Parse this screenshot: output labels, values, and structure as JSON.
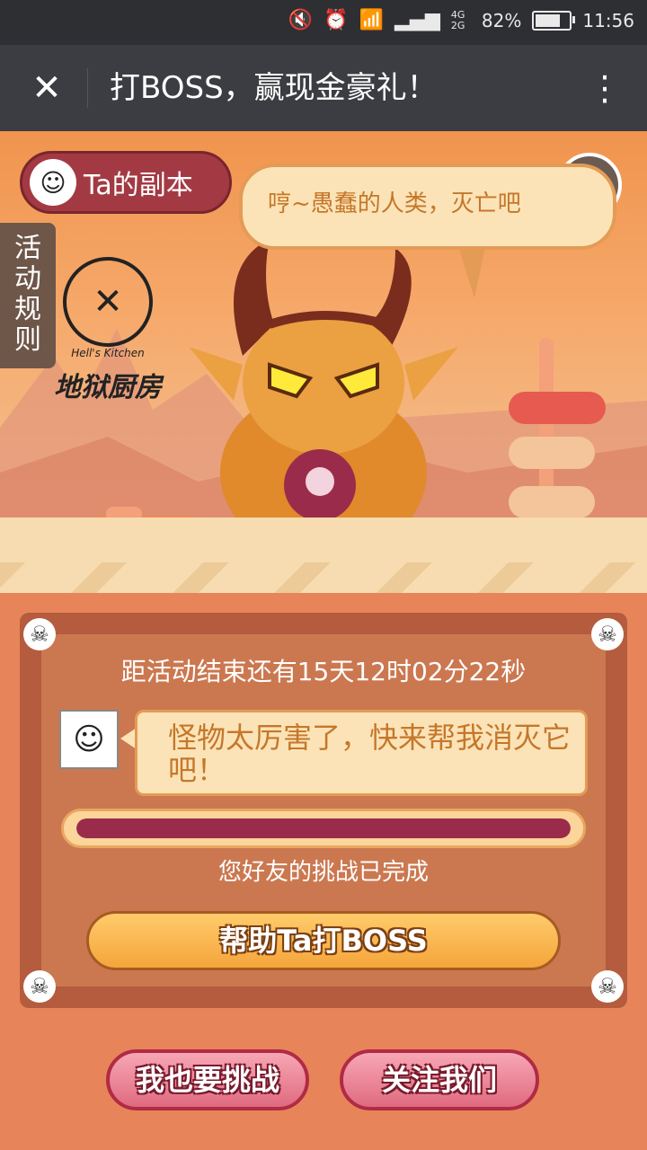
{
  "status_bar": {
    "icons": [
      "mute-icon",
      "alarm-icon",
      "wifi-icon",
      "signal-icon"
    ],
    "network": "4G 2G",
    "battery_percent": "82%",
    "battery_level": 0.82,
    "time": "11:56"
  },
  "nav": {
    "close_icon": "close-icon",
    "title": "打BOSS，赢现金豪礼！",
    "more_icon": "more-vertical-icon"
  },
  "scene": {
    "copy_tab_label": "Ta的副本",
    "rules_label": "活动规则",
    "music_icon": "music-note-icon",
    "boss_speech": "哼~愚蠢的人类，灭亡吧",
    "logo_text_en": "Hell's Kitchen",
    "logo_text_cn": "地狱厨房"
  },
  "panel": {
    "countdown": "距活动结束还有15天12时02分22秒",
    "friend_message": "怪物太厉害了，快来帮我消灭它吧！",
    "progress_fraction": 1.0,
    "progress_text": "您好友的挑战已完成",
    "help_button": "帮助Ta打BOSS"
  },
  "actions": {
    "challenge_button": "我也要挑战",
    "follow_button": "关注我们"
  },
  "colors": {
    "nav_bg": "#3b3d42",
    "panel_bg": "#b45c3d",
    "progress_bar": "#9b2b4b",
    "help_button": "#f5a53b",
    "pink_button": "#e06a80"
  }
}
